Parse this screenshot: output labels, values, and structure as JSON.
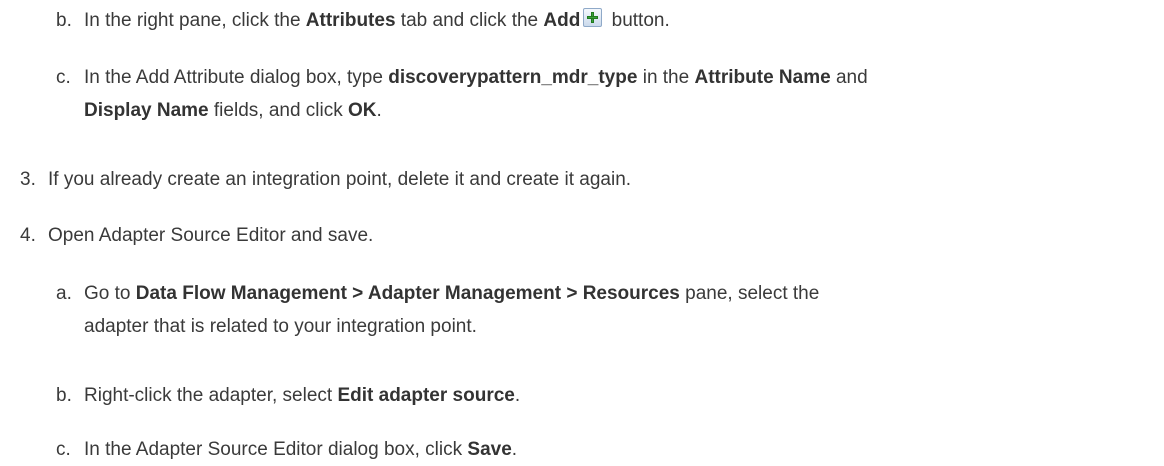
{
  "steps": [
    {
      "marker": "b.",
      "parts": [
        {
          "t": "In the right pane, click the "
        },
        {
          "t": "Attributes",
          "b": true
        },
        {
          "t": " tab and click the "
        },
        {
          "t": "Add",
          "b": true
        },
        {
          "icon": "add-icon"
        },
        {
          "t": " button."
        }
      ]
    },
    {
      "marker": "c.",
      "line1": [
        {
          "t": "In the Add Attribute dialog box, type "
        },
        {
          "t": "discoverypattern_mdr_type",
          "b": true
        },
        {
          "t": " in the "
        },
        {
          "t": "Attribute Name",
          "b": true
        },
        {
          "t": " and"
        }
      ],
      "line2": [
        {
          "t": "Display Name",
          "b": true
        },
        {
          "t": " fields, and click "
        },
        {
          "t": "OK",
          "b": true
        },
        {
          "t": "."
        }
      ]
    },
    {
      "marker": "3.",
      "text": "If you already create an integration point, delete it and create it again."
    },
    {
      "marker": "4.",
      "text": "Open Adapter Source Editor and save."
    },
    {
      "marker": "a.",
      "line1": [
        {
          "t": "Go to "
        },
        {
          "t": "Data Flow Management > Adapter Management > Resources",
          "b": true
        },
        {
          "t": " pane, select the"
        }
      ],
      "line2_text": "adapter that is related to your integration point."
    },
    {
      "marker": "b.",
      "parts": [
        {
          "t": "Right-click the adapter, select "
        },
        {
          "t": "Edit adapter source",
          "b": true
        },
        {
          "t": "."
        }
      ]
    },
    {
      "marker": "c.",
      "parts": [
        {
          "t": "In the Adapter Source Editor dialog box, click "
        },
        {
          "t": "Save",
          "b": true
        },
        {
          "t": "."
        }
      ]
    }
  ]
}
